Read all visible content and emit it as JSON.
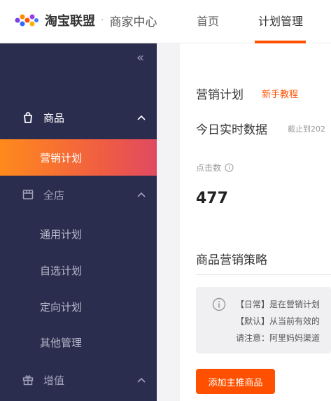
{
  "header": {
    "brand": "淘宝联盟",
    "brand_sub": "商家中心",
    "nav": [
      {
        "label": "首页"
      },
      {
        "label": "计划管理"
      }
    ],
    "accent_color": "#ff5000"
  },
  "sidebar": {
    "collapse_glyph": "«",
    "groups": [
      {
        "label": "商品",
        "icon": "shopping-bag-icon",
        "expanded": true
      },
      {
        "label": "全店",
        "icon": "store-icon",
        "expanded": true
      },
      {
        "label": "增值",
        "icon": "gift-icon",
        "expanded": true
      }
    ],
    "items": [
      {
        "label": "营销计划",
        "active": true
      },
      {
        "label": "通用计划"
      },
      {
        "label": "自选计划"
      },
      {
        "label": "定向计划"
      },
      {
        "label": "其他管理"
      }
    ],
    "bg_color": "#2b2d4f"
  },
  "main": {
    "title": "营销计划",
    "tutorial_link": "新手教程",
    "today_title": "今日实时数据",
    "cutoff": "截止到202",
    "clicks_label": "点击数",
    "clicks_value": "477",
    "strategy_title": "商品营销策略",
    "notice_lines": [
      "【日常】是在营销计划",
      "【默认】从当前有效的",
      "请注意：阿里妈妈渠道"
    ],
    "add_button": "添加主推商品"
  }
}
